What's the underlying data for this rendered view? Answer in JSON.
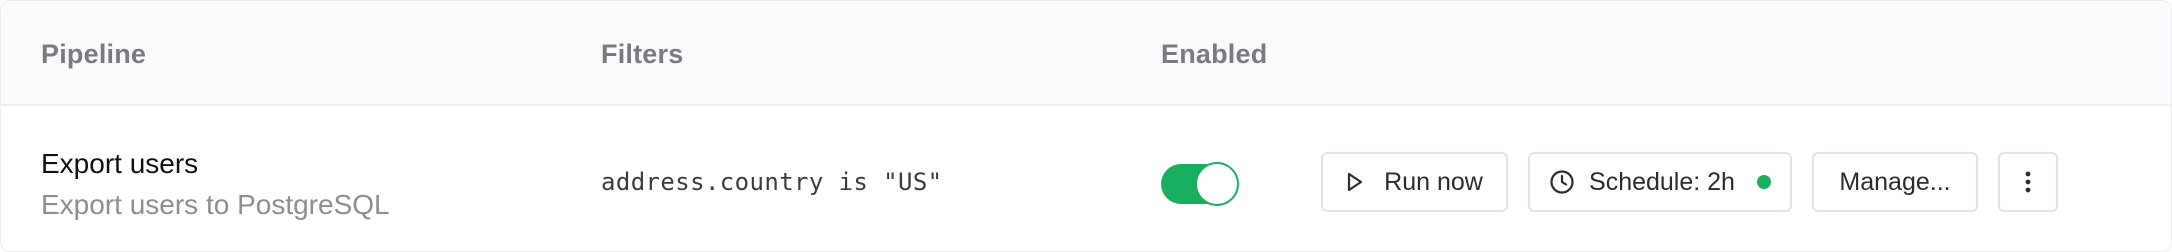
{
  "table": {
    "columns": {
      "pipeline": "Pipeline",
      "filters": "Filters",
      "enabled": "Enabled"
    },
    "rows": [
      {
        "name": "Export users",
        "description": "Export users to PostgreSQL",
        "filter": "address.country is \"US\"",
        "enabled": true,
        "actions": {
          "run_label": "Run now",
          "schedule_label": "Schedule: 2h",
          "schedule_status": "active",
          "manage_label": "Manage..."
        }
      }
    ]
  },
  "icons": {
    "run": "play-icon",
    "schedule": "clock-icon",
    "more": "more-vertical-icon"
  },
  "colors": {
    "accent_green": "#18b060",
    "header_bg": "#fbfbfd",
    "muted_text": "#8d8e93"
  }
}
